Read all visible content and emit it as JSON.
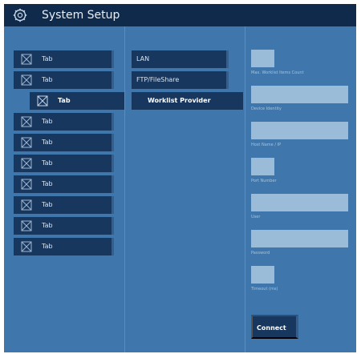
{
  "header": {
    "title": "System Setup",
    "icon": "gear-icon"
  },
  "tabs": [
    {
      "label": "Tab",
      "active": false
    },
    {
      "label": "Tab",
      "active": false
    },
    {
      "label": "Tab",
      "active": true
    },
    {
      "label": "Tab",
      "active": false
    },
    {
      "label": "Tab",
      "active": false
    },
    {
      "label": "Tab",
      "active": false
    },
    {
      "label": "Tab",
      "active": false
    },
    {
      "label": "Tab",
      "active": false
    },
    {
      "label": "Tab",
      "active": false
    },
    {
      "label": "Tab",
      "active": false
    }
  ],
  "subtabs": [
    {
      "label": "LAN",
      "selected": false
    },
    {
      "label": "FTP/FileShare",
      "selected": false
    },
    {
      "label": "Worklist Provider",
      "selected": true
    }
  ],
  "form": {
    "fields": [
      {
        "name": "max-worklist-items-count",
        "label": "Max. Worklist Items Count",
        "value": ""
      },
      {
        "name": "device-identity",
        "label": "Device Identity",
        "value": ""
      },
      {
        "name": "host-name-ip",
        "label": "Host Name / IP",
        "value": ""
      },
      {
        "name": "port-number",
        "label": "Port Number",
        "value": ""
      },
      {
        "name": "user",
        "label": "User",
        "value": ""
      },
      {
        "name": "password",
        "label": "Password",
        "value": ""
      },
      {
        "name": "timeout",
        "label": "Timeout (ms)",
        "value": ""
      }
    ],
    "connect_label": "Connect"
  },
  "colors": {
    "background": "#3f76ab",
    "header": "#102a4c",
    "button": "#17375f",
    "field": "#9bbcd9",
    "label": "#a9c4dd"
  }
}
